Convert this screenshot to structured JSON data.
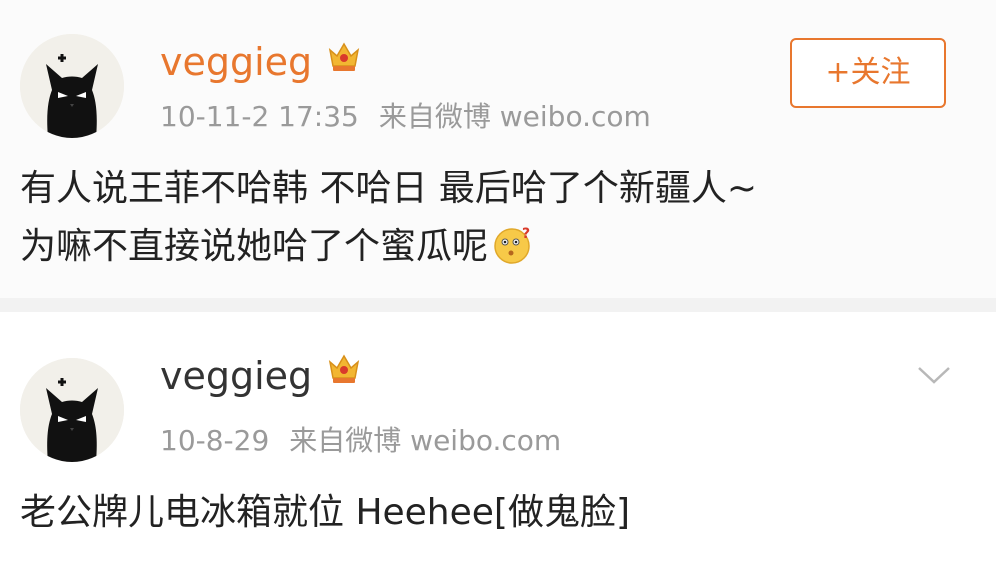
{
  "posts": [
    {
      "username": "veggieg",
      "time": "10-11-2 17:35",
      "source": "来自微博 weibo.com",
      "content_line1": "有人说王菲不哈韩 不哈日 最后哈了个新疆人~",
      "content_line2": "为嘛不直接说她哈了个蜜瓜呢",
      "follow_label": "+关注",
      "avatar_icon": "black-cat-icon",
      "badge_icon": "crown-badge-icon",
      "emoji_icon": "thinking-face-emoji"
    },
    {
      "username": "veggieg",
      "time": "10-8-29",
      "source": "来自微博 weibo.com",
      "content": "老公牌儿电冰箱就位 Heehee[做鬼脸]",
      "avatar_icon": "black-cat-icon",
      "badge_icon": "crown-badge-icon",
      "menu_icon": "chevron-down-icon"
    }
  ],
  "colors": {
    "accent": "#e8772e",
    "username_default": "#333333",
    "meta_text": "#9a9a9a",
    "body_text": "#222222"
  }
}
